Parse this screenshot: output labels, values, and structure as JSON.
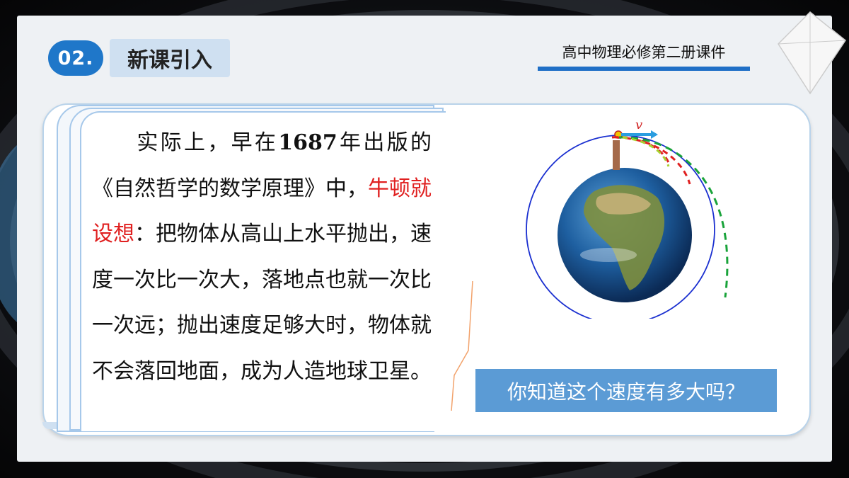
{
  "header": {
    "section_number": "02.",
    "section_title": "新课引入",
    "course_label": "高中物理必修第二册课件"
  },
  "content": {
    "para_1": "实际上，早在",
    "year": "1687",
    "para_2": "年出版的《自然哲学的数学原理》中，",
    "highlight": "牛顿就设想",
    "para_3": "：把物体从高山上水平抛出，速度一次比一次大，落地点也就一次比一次远；抛出速度足够大时，物体就不会落回地面，成为人造地球卫星。"
  },
  "diagram": {
    "velocity_label": "v"
  },
  "question": "你知道这个速度有多大吗？",
  "colors": {
    "accent_blue": "#1f77c9",
    "highlight_red": "#e02020",
    "question_bg": "#5b9bd5"
  }
}
